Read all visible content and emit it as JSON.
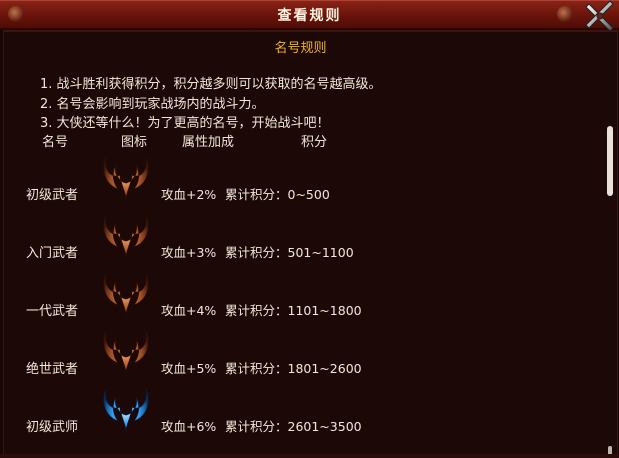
{
  "window": {
    "title": "查看规则"
  },
  "heading": "名号规则",
  "rules": [
    "1.  战斗胜利获得积分，积分越多则可以获取的名号越高级。",
    "2.  名号会影响到玩家战场内的战斗力。",
    "3.  大侠还等什么！为了更高的名号，开始战斗吧！"
  ],
  "columns": [
    "名号",
    "图标",
    "属性加成",
    "积分"
  ],
  "rows": [
    {
      "name": "初级武者",
      "icon": "bronze-horns-icon",
      "bonus": "攻血+2%",
      "score": "累计积分：0~500"
    },
    {
      "name": "入门武者",
      "icon": "bronze-horns-icon",
      "bonus": "攻血+3%",
      "score": "累计积分：501~1100"
    },
    {
      "name": "一代武者",
      "icon": "bronze-horns-icon",
      "bonus": "攻血+4%",
      "score": "累计积分：1101~1800"
    },
    {
      "name": "绝世武者",
      "icon": "bronze-horns-icon",
      "bonus": "攻血+5%",
      "score": "累计积分：1801~2600"
    },
    {
      "name": "初级武师",
      "icon": "blue-horns-icon",
      "bonus": "攻血+6%",
      "score": "累计积分：2601~3500"
    }
  ],
  "colors": {
    "title_bar": "#6a140b",
    "panel_bg": "#1c0907",
    "heading": "#f0b21d",
    "text": "#f1e6d8",
    "bronze_icon": "#c9743a",
    "blue_icon": "#3aa8ff"
  }
}
